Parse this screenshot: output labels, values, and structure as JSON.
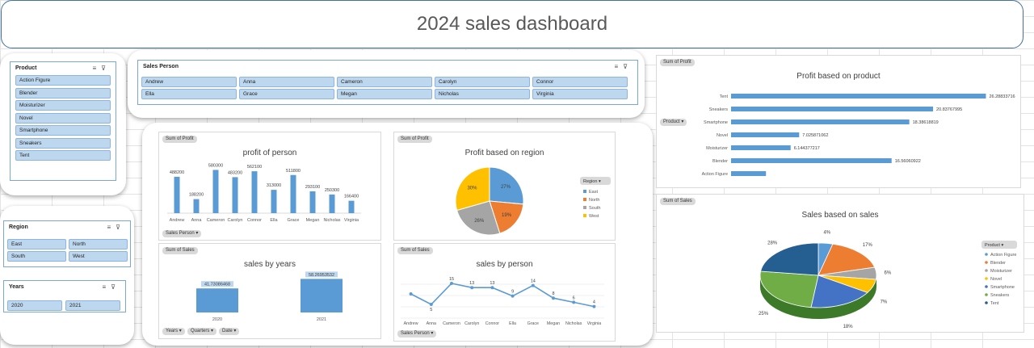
{
  "title": "2024 sales dashboard",
  "product_slicer": {
    "header": "Product",
    "items": [
      "Action Figure",
      "Blender",
      "Moisturizer",
      "Novel",
      "Smartphone",
      "Sneakers",
      "Tent"
    ]
  },
  "salesperson_slicer": {
    "header": "Sales Person",
    "items": [
      "Andrew",
      "Anna",
      "Cameron",
      "Carolyn",
      "Connor",
      "Ella",
      "Grace",
      "Megan",
      "Nicholas",
      "Virginia"
    ]
  },
  "region_slicer": {
    "header": "Region",
    "items": [
      "East",
      "North",
      "South",
      "West"
    ]
  },
  "years_slicer": {
    "header": "Years",
    "items": [
      "2020",
      "2021"
    ]
  },
  "profit_person": {
    "field": "Sum of Profit",
    "filter": "Sales Person",
    "chart_data": {
      "type": "bar",
      "title": "profit of person",
      "categories": [
        "Andrew",
        "Anna",
        "Cameron",
        "Carolyn",
        "Connor",
        "Ella",
        "Grace",
        "Megan",
        "Nicholas",
        "Virginia"
      ],
      "values": [
        488200,
        188200,
        580300,
        483200,
        562100,
        313000,
        511800,
        293100,
        250300,
        166400
      ],
      "value_labels": [
        "488200",
        "188200",
        "580300",
        "483200",
        "562100",
        "313000",
        "511800",
        "293100",
        "250300",
        "166400"
      ],
      "ylim": [
        0,
        650000
      ],
      "color": "#5b9bd5"
    }
  },
  "profit_region": {
    "field": "Sum of Profit",
    "legend_title": "Region",
    "chart_data": {
      "type": "pie",
      "title": "Profit based on region",
      "labels": [
        "East",
        "North",
        "South",
        "West"
      ],
      "values": [
        27,
        19,
        26,
        30
      ],
      "value_labels": [
        "27%",
        "19%",
        "26%",
        "30%"
      ],
      "colors": [
        "#5b9bd5",
        "#ed7d31",
        "#a5a5a5",
        "#ffc000"
      ]
    }
  },
  "sales_years": {
    "field": "Sum of Sales",
    "filters": [
      "Years",
      "Quarters",
      "Date"
    ],
    "chart_data": {
      "type": "bar",
      "title": "sales by years",
      "categories": [
        "2020",
        "2021"
      ],
      "values": [
        41.73086468,
        58.26953532
      ],
      "value_labels": [
        "41.73086468",
        "58.26953532"
      ],
      "ylim": [
        0,
        70
      ],
      "color": "#5b9bd5"
    }
  },
  "sales_person": {
    "field": "Sum of Sales",
    "filter": "Sales Person",
    "chart_data": {
      "type": "line",
      "title": "sales by person",
      "categories": [
        "Andrew",
        "Anna",
        "Cameron",
        "Carolyn",
        "Connor",
        "Ella",
        "Grace",
        "Megan",
        "Nicholas",
        "Virginia"
      ],
      "values": [
        10,
        5,
        15,
        13,
        13,
        9,
        14,
        8,
        6,
        4
      ],
      "value_labels": [
        "",
        "5",
        "15",
        "13",
        "13",
        "9",
        "14",
        "8",
        "6",
        "4"
      ],
      "ylim": [
        0,
        20
      ],
      "color": "#5b9bd5"
    }
  },
  "profit_product": {
    "field": "Sum of Profit",
    "filter": "Product",
    "chart_data": {
      "type": "bar",
      "orientation": "horizontal",
      "title": "Profit based on product",
      "categories": [
        "Tent",
        "Sneakers",
        "Smartphone",
        "Novel",
        "Moisturizer",
        "Blender",
        "Action Figure"
      ],
      "values": [
        26.28833716,
        20.83767995,
        18.38618819,
        7.025871062,
        6.144377217,
        16.56060922,
        3.6
      ],
      "value_labels": [
        "26.28833716",
        "20.83767995",
        "18.38618819",
        "7.025871062",
        "6.144377217",
        "16.56060922",
        ""
      ],
      "xlim": [
        0,
        30
      ],
      "color": "#5b9bd5"
    }
  },
  "sales_product": {
    "field": "Sum of Sales",
    "legend_title": "Product",
    "chart_data": {
      "type": "pie",
      "title": "Sales based on sales",
      "labels": [
        "Action Figure",
        "Blender",
        "Moisturizer",
        "Novel",
        "Smartphone",
        "Sneakers",
        "Tent"
      ],
      "values": [
        4,
        17,
        6,
        7,
        18,
        25,
        23
      ],
      "value_labels": [
        "4%",
        "17%",
        "6%",
        "7%",
        "18%",
        "25%",
        "28%"
      ],
      "colors": [
        "#5b9bd5",
        "#ed7d31",
        "#a5a5a5",
        "#ffc000",
        "#4472c4",
        "#70ad47",
        "#255e91"
      ]
    }
  }
}
